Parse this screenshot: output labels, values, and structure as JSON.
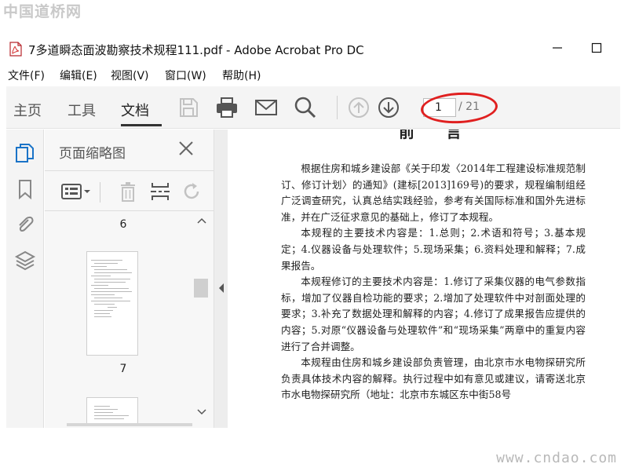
{
  "watermarks": {
    "top": "中国道桥网",
    "bottom": "www.cndao.com"
  },
  "window": {
    "title": "7多道瞬态面波勘察技术规程111.pdf - Adobe Acrobat Pro DC"
  },
  "menu": [
    "文件(F)",
    "编辑(E)",
    "视图(V)",
    "窗口(W)",
    "帮助(H)"
  ],
  "toolbar": {
    "tabs": [
      "主页",
      "工具",
      "文档"
    ],
    "active_tab": "文档",
    "current_page": "1",
    "total_pages": "/ 21",
    "icons": [
      "save-icon",
      "print-icon",
      "email-icon",
      "search-icon",
      "page-up-icon",
      "page-down-icon"
    ],
    "annotation_color": "#e02020"
  },
  "left_nav": {
    "icons": [
      "page-thumbnails-icon",
      "bookmark-icon",
      "attachment-icon",
      "layers-icon"
    ],
    "active_color": "#1a73c7"
  },
  "thumbnail_panel": {
    "title": "页面缩略图",
    "tools": [
      "thumbnail-options-icon",
      "delete-page-icon",
      "insert-page-icon",
      "rotate-page-icon"
    ],
    "page_labels": [
      "6",
      "7"
    ]
  },
  "document": {
    "heading": "前言",
    "paragraphs": [
      "根据住房和城乡建设部《关于印发〈2014年工程建设标准规范制订、修订计划〉的通知》(建标[2013]169号)的要求，规程编制组经广泛调查研究，认真总结实践经验，参考有关国际标准和国外先进标准，并在广泛征求意见的基础上，修订了本规程。",
      "本规程的主要技术内容是：1.总则；2.术语和符号；3.基本规定；4.仪器设备与处理软件；5.现场采集；6.资料处理和解释；7.成果报告。",
      "本规程修订的主要技术内容是：1.修订了采集仪器的电气参数指标，增加了仪器自检功能的要求；2.增加了处理软件中对剖面处理的要求；3.补充了数据处理和解释的内容；4.修订了成果报告应提供的内容；5.对原“仪器设备与处理软件”和“现场采集”两章中的重复内容进行了合并调整。",
      "本规程由住房和城乡建设部负责管理，由北京市水电物探研究所负责具体技术内容的解释。执行过程中如有意见或建议，请寄送北京市水电物探研究所（地址：北京市东城区东中街58号"
    ]
  }
}
